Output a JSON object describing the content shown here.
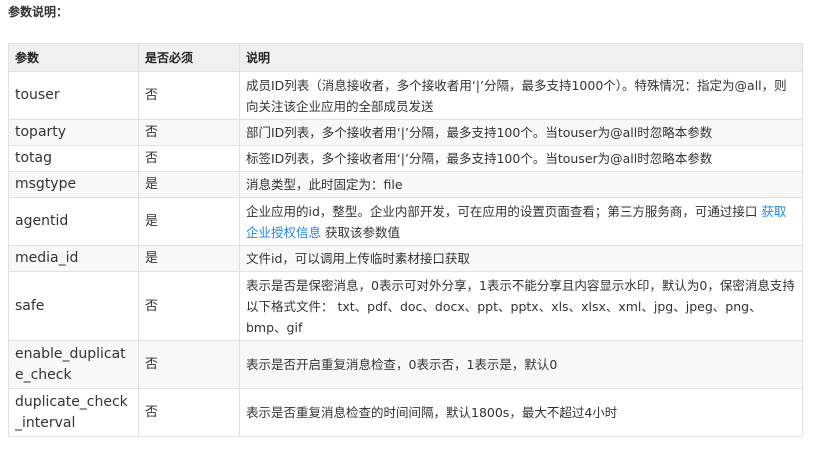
{
  "page": {
    "title": "参数说明："
  },
  "table": {
    "headers": [
      "参数",
      "是否必须",
      "说明"
    ],
    "rows": [
      {
        "name": "touser",
        "required": "否",
        "desc": "成员ID列表（消息接收者，多个接收者用‘|’分隔，最多支持1000个）。特殊情况：指定为@all，则向关注该企业应用的全部成员发送"
      },
      {
        "name": "toparty",
        "required": "否",
        "desc": "部门ID列表，多个接收者用‘|’分隔，最多支持100个。当touser为@all时忽略本参数"
      },
      {
        "name": "totag",
        "required": "否",
        "desc": "标签ID列表，多个接收者用‘|’分隔，最多支持100个。当touser为@all时忽略本参数"
      },
      {
        "name": "msgtype",
        "required": "是",
        "desc": "消息类型，此时固定为：file"
      },
      {
        "name": "agentid",
        "required": "是",
        "desc_before": "企业应用的id，整型。企业内部开发，可在应用的设置页面查看；第三方服务商，可通过接口 ",
        "desc_link": "获取企业授权信息",
        "desc_after": " 获取该参数值"
      },
      {
        "name": "media_id",
        "required": "是",
        "desc": "文件id，可以调用上传临时素材接口获取"
      },
      {
        "name": "safe",
        "required": "否",
        "desc": "表示是否是保密消息，0表示可对外分享，1表示不能分享且内容显示水印，默认为0，保密消息支持以下格式文件： txt、pdf、doc、docx、ppt、pptx、xls、xlsx、xml、jpg、jpeg、png、bmp、gif"
      },
      {
        "name": "enable_duplicate_check",
        "required": "否",
        "desc": "表示是否开启重复消息检查，0表示否，1表示是，默认0"
      },
      {
        "name": "duplicate_check_interval",
        "required": "否",
        "desc": "表示是否重复消息检查的时间间隔，默认1800s，最大不超过4小时"
      }
    ]
  },
  "colors": {
    "header_bg": "#f0f0f0",
    "row_alt_bg": "#f8f8f8",
    "border": "#dfe2e5",
    "link": "#1e88e5",
    "text": "#333333"
  }
}
